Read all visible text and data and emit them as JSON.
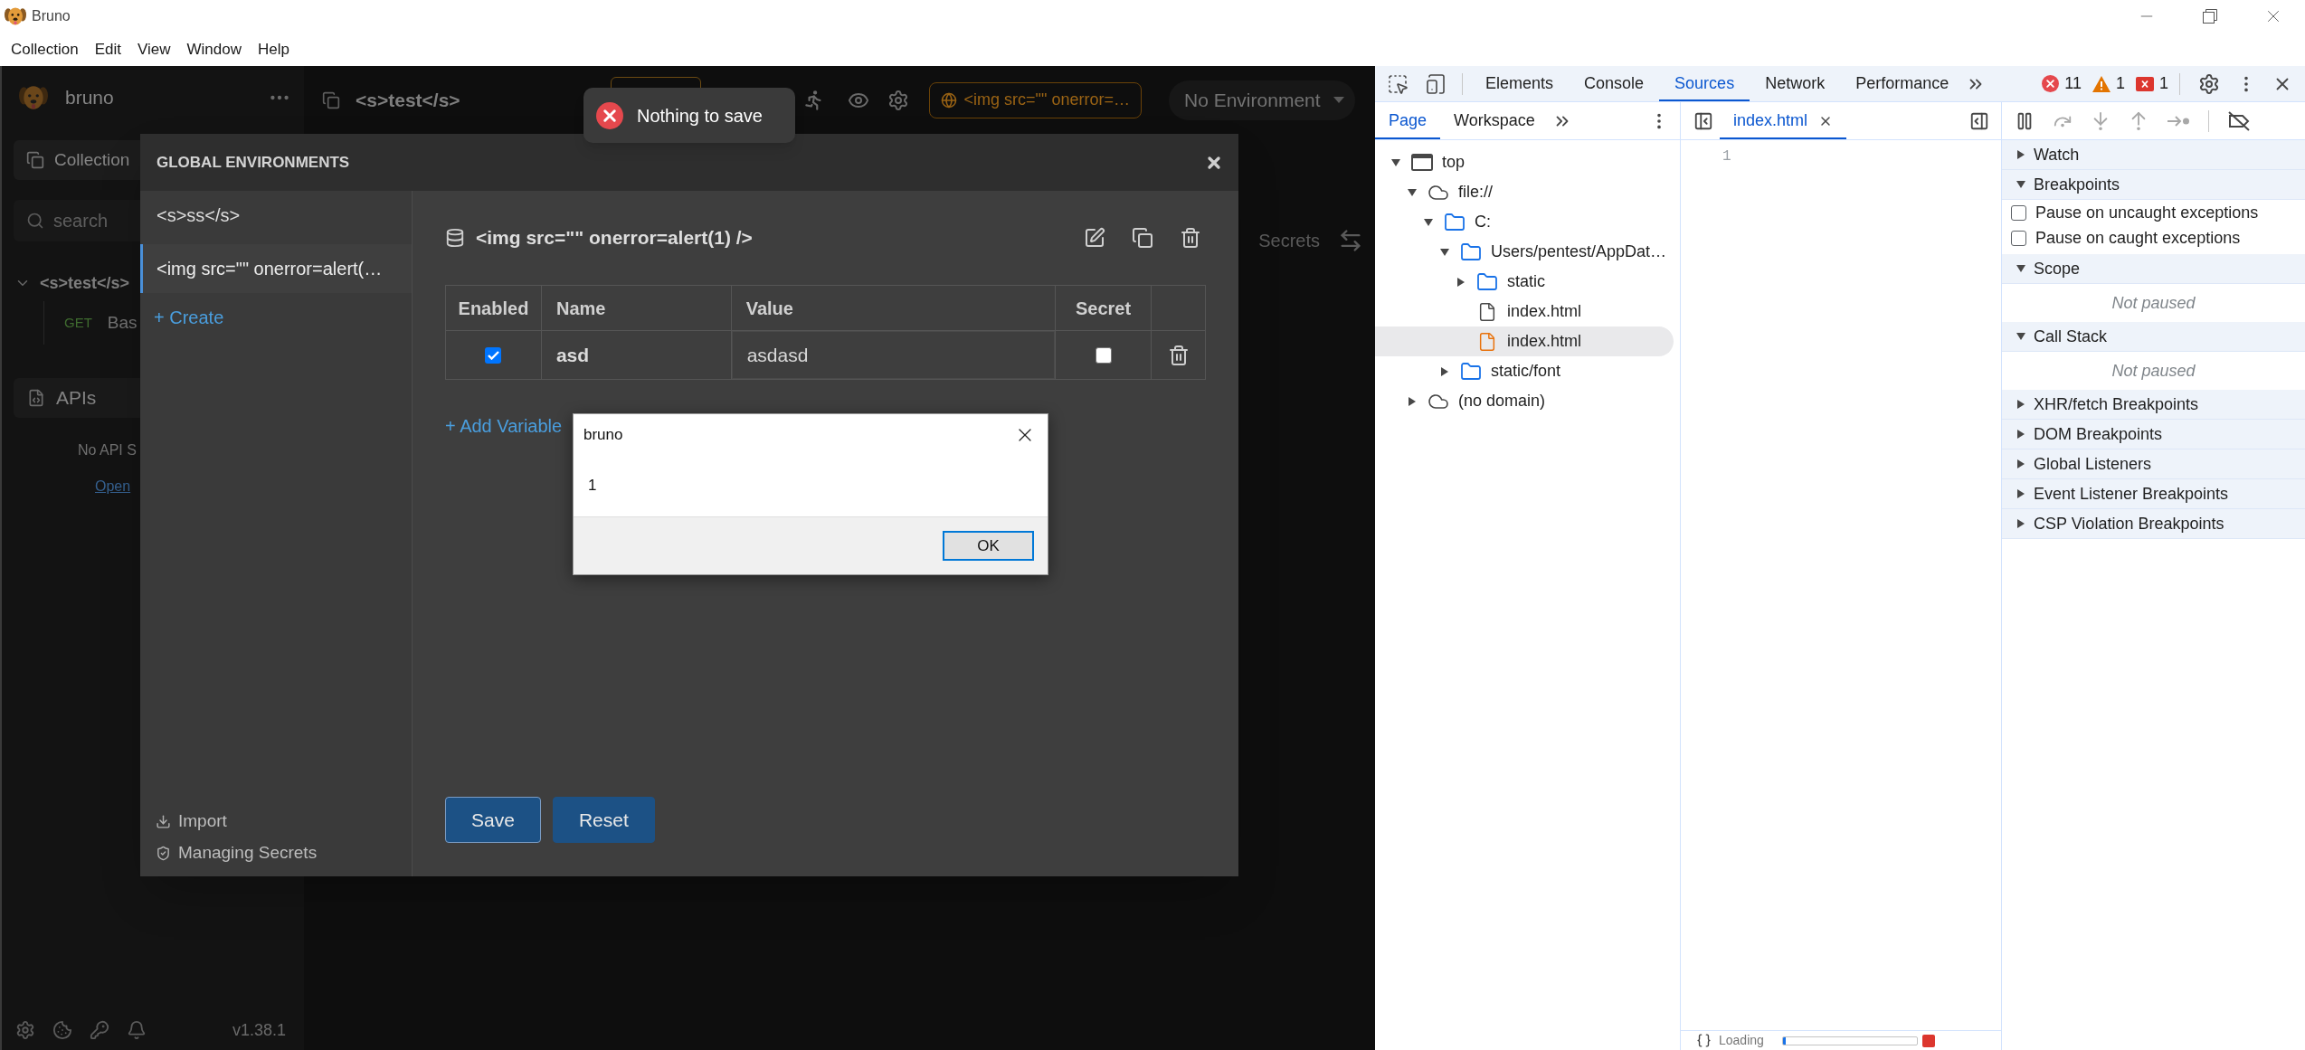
{
  "window": {
    "title": "Bruno",
    "menu": [
      "Collection",
      "Edit",
      "View",
      "Window",
      "Help"
    ]
  },
  "sidebar": {
    "app_name": "bruno",
    "collections_button": "Collection",
    "search": {
      "placeholder": "search"
    },
    "collections": [
      {
        "name": "<s>test</s>",
        "expanded": true,
        "requests": [
          {
            "method": "GET",
            "name": "Bas"
          }
        ]
      }
    ],
    "apis": {
      "title": "APIs",
      "empty_text": "No API S",
      "link": "Open"
    },
    "version": "v1.38.1"
  },
  "main": {
    "collection_title": "<s>test</s>",
    "environment_chip": "<img src=\"\" onerror=…",
    "environment_select": "No Environment",
    "side_tab": "Secrets"
  },
  "toast": {
    "text": "Nothing to save"
  },
  "modal": {
    "title": "GLOBAL ENVIRONMENTS",
    "environments": [
      {
        "name": "<s>ss</s>",
        "selected": false
      },
      {
        "name": "<img src=\"\" onerror=alert(…",
        "selected": true
      }
    ],
    "create": "+ Create",
    "footer_links": [
      {
        "kind": "import",
        "label": "Import"
      },
      {
        "kind": "secrets",
        "label": "Managing Secrets"
      }
    ],
    "environment_title": "<img src=\"\" onerror=alert(1) />",
    "table": {
      "columns": [
        "Enabled",
        "Name",
        "Value",
        "Secret"
      ],
      "rows": [
        {
          "enabled": true,
          "name": "asd",
          "value": "asdasd",
          "secret": false
        }
      ]
    },
    "add_variable": "+ Add Variable",
    "buttons": [
      {
        "label": "Save",
        "focused": true
      },
      {
        "label": "Reset",
        "focused": false
      }
    ]
  },
  "alert": {
    "title": "bruno",
    "message": "1",
    "button": "OK"
  },
  "devtools": {
    "tabs": [
      {
        "label": "Elements",
        "selected": false
      },
      {
        "label": "Console",
        "selected": false
      },
      {
        "label": "Sources",
        "selected": true
      },
      {
        "label": "Network",
        "selected": false
      },
      {
        "label": "Performance",
        "selected": false
      }
    ],
    "counters": [
      {
        "kind": "error",
        "count": "11"
      },
      {
        "kind": "warning",
        "count": "1"
      },
      {
        "kind": "issue",
        "count": "1"
      }
    ],
    "navigator_tabs": [
      {
        "label": "Page",
        "selected": true
      },
      {
        "label": "Workspace",
        "selected": false
      }
    ],
    "tree": [
      {
        "label": "top",
        "kind": "frame",
        "expanded": true,
        "selected": false,
        "children": [
          {
            "label": "file://",
            "kind": "cloud",
            "expanded": true,
            "selected": false,
            "children": [
              {
                "label": "C:",
                "kind": "folder",
                "expanded": true,
                "selected": false,
                "children": [
                  {
                    "label": "Users/pentest/AppDat…",
                    "kind": "folder",
                    "expanded": true,
                    "selected": false,
                    "children": [
                      {
                        "label": "static",
                        "kind": "folder",
                        "expanded": false,
                        "selected": false
                      },
                      {
                        "label": "index.html",
                        "kind": "file",
                        "selected": false
                      },
                      {
                        "label": "index.html",
                        "kind": "document",
                        "selected": true
                      }
                    ]
                  },
                  {
                    "label": "static/font",
                    "kind": "folder",
                    "expanded": false,
                    "selected": false
                  }
                ]
              }
            ]
          },
          {
            "label": "(no domain)",
            "kind": "cloud",
            "expanded": false,
            "selected": false
          }
        ]
      }
    ],
    "editor": {
      "tabs": [
        {
          "label": "index.html",
          "selected": true
        }
      ],
      "line_numbers": [
        "1"
      ],
      "status": "Loading",
      "progress": {
        "level": 0.02
      }
    },
    "debugger": {
      "sections": [
        {
          "title": "Watch",
          "expanded": false
        },
        {
          "title": "Breakpoints",
          "expanded": true,
          "options": [
            {
              "label": "Pause on uncaught exceptions",
              "checked": false
            },
            {
              "label": "Pause on caught exceptions",
              "checked": false
            }
          ]
        },
        {
          "title": "Scope",
          "expanded": true,
          "message": "Not paused"
        },
        {
          "title": "Call Stack",
          "expanded": true,
          "message": "Not paused"
        },
        {
          "title": "XHR/fetch Breakpoints",
          "expanded": false
        },
        {
          "title": "DOM Breakpoints",
          "expanded": false
        },
        {
          "title": "Global Listeners",
          "expanded": false
        },
        {
          "title": "Event Listener Breakpoints",
          "expanded": false
        },
        {
          "title": "CSP Violation Breakpoints",
          "expanded": false
        }
      ]
    }
  }
}
